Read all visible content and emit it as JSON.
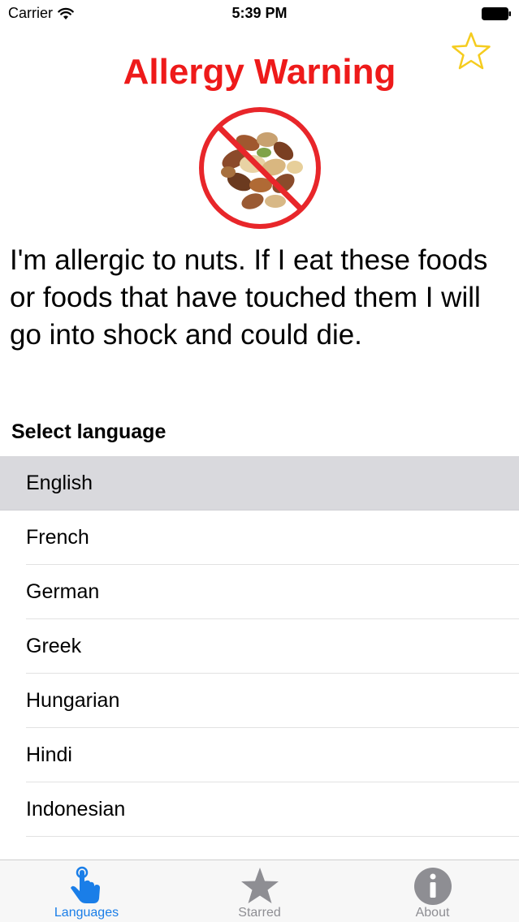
{
  "status_bar": {
    "carrier": "Carrier",
    "time": "5:39 PM"
  },
  "header": {
    "title": "Allergy Warning",
    "title_color": "#ee1a1a"
  },
  "message": "I'm allergic to nuts. If I eat these foods or foods that have touched them I will go into shock and could die.",
  "languages": {
    "header": "Select language",
    "items": [
      {
        "label": "English",
        "selected": true
      },
      {
        "label": "French",
        "selected": false
      },
      {
        "label": "German",
        "selected": false
      },
      {
        "label": "Greek",
        "selected": false
      },
      {
        "label": "Hungarian",
        "selected": false
      },
      {
        "label": "Hindi",
        "selected": false
      },
      {
        "label": "Indonesian",
        "selected": false
      }
    ]
  },
  "tab_bar": {
    "active_color": "#1a7ee8",
    "inactive_color": "#8e8e93",
    "tabs": [
      {
        "label": "Languages",
        "icon": "tap-hand-icon",
        "active": true
      },
      {
        "label": "Starred",
        "icon": "star-icon",
        "active": false
      },
      {
        "label": "About",
        "icon": "info-icon",
        "active": false
      }
    ]
  }
}
